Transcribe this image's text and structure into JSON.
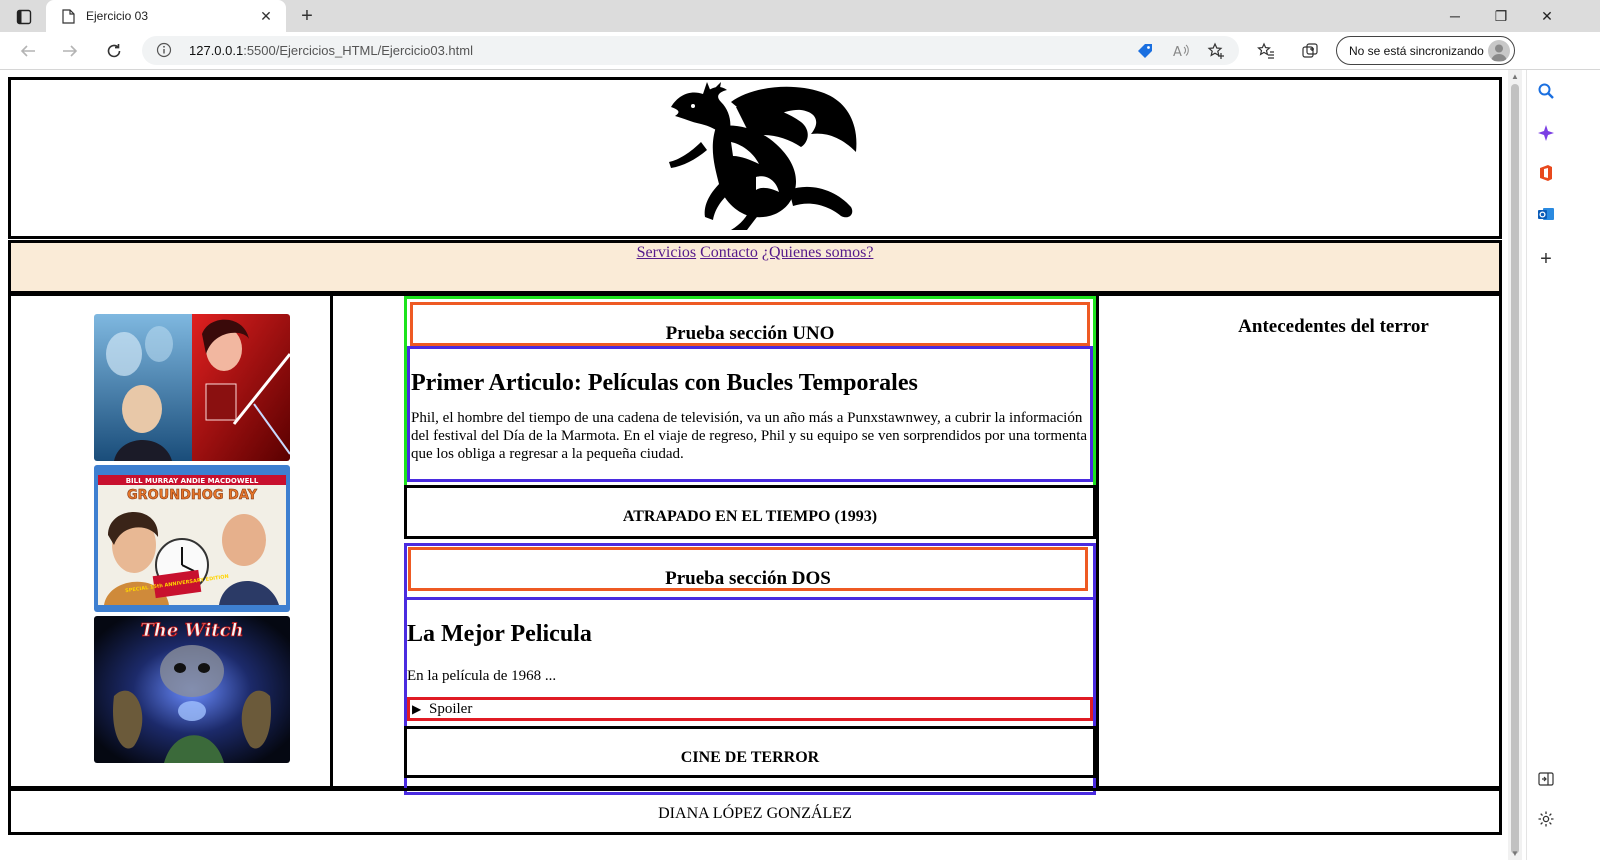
{
  "browser": {
    "tab_title": "Ejercicio 03",
    "url_host": "127.0.0.1",
    "url_rest": ":5500/Ejercicios_HTML/Ejercicio03.html",
    "sync_label": "No se está sincronizando"
  },
  "page": {
    "nav_links": [
      "Servicios",
      "Contacto",
      "¿Quienes somos?"
    ],
    "section_one_heading": "Prueba sección UNO",
    "article_one_title": "Primer Articulo: Películas con Bucles Temporales",
    "article_one_text": "Phil, el hombre del tiempo de una cadena de televisión, va un año más a Punxstawnwey, a cubrir la información del festival del Día de la Marmota. En el viaje de regreso, Phil y su equipo se ven sorprendidos por una tormenta que los obliga a regresar a la pequeña ciudad.",
    "article_one_footer": "ATRAPADO EN EL TIEMPO (1993)",
    "section_two_heading": "Prueba sección DOS",
    "article_two_title": "La Mejor Pelicula",
    "article_two_text": "En la película de 1968 ...",
    "spoiler_label": "Spoiler",
    "article_two_footer": "CINE DE TERROR",
    "aside_right_title": "Antecedentes del terror",
    "footer_text": "DIANA LÓPEZ GONZÁLEZ",
    "posters": [
      {
        "name": "horror-collage-poster",
        "text": ""
      },
      {
        "name": "groundhog-day-poster",
        "top_text": "BILL MURRAY   ANDIE MACDOWELL",
        "title": "GROUNDHOG DAY",
        "badge": "SPECIAL 15th ANNIVERSARY EDITION"
      },
      {
        "name": "the-witch-poster",
        "title": "The Witch"
      }
    ]
  },
  "colors": {
    "nav_bg": "#faebd7",
    "section_green": "#1de31d",
    "heading_orange": "#ee5a23",
    "article_purple": "#4a2be0",
    "spoiler_red": "#e01b24",
    "link": "#551a8b"
  }
}
